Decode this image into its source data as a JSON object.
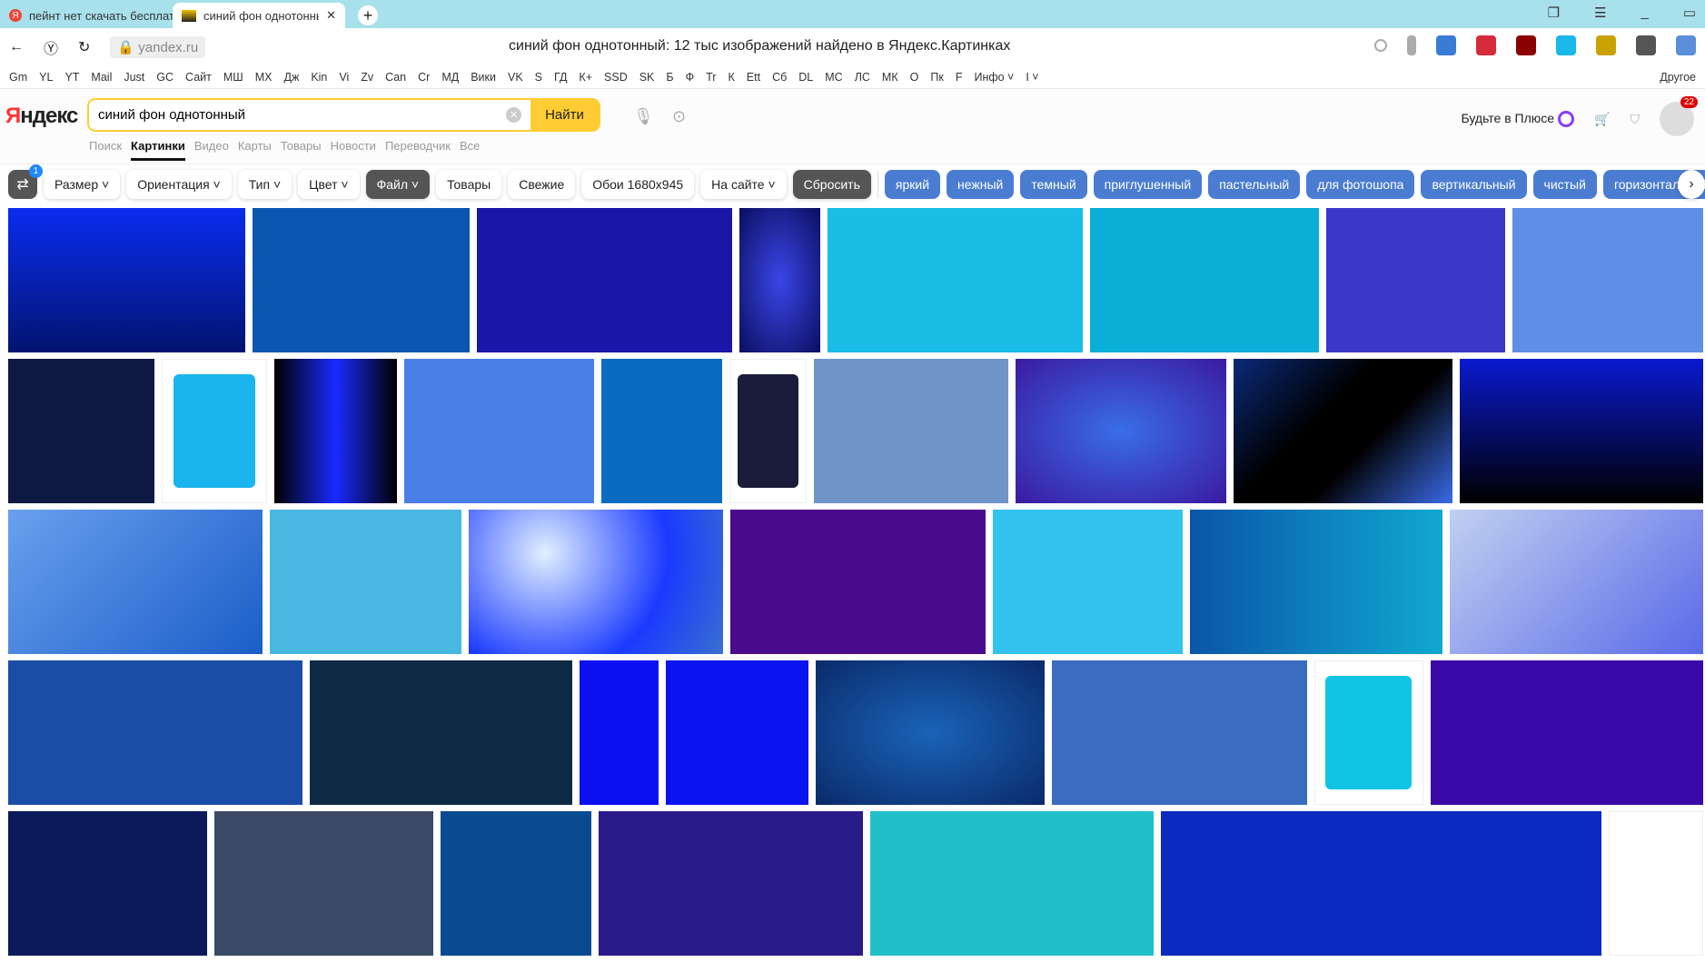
{
  "browser": {
    "tabs": [
      {
        "label": "пейнт нет скачать бесплатно",
        "active": false
      },
      {
        "label": "синий фон однотонный",
        "active": true
      }
    ],
    "url": "yandex.ru",
    "page_title": "синий фон однотонный: 12 тыс изображений найдено в Яндекс.Картинках",
    "bookmarks": [
      "Gm",
      "YL",
      "YT",
      "Mail",
      "Just",
      "GC",
      "Сайт",
      "МШ",
      "МХ",
      "Дж",
      "Kin",
      "Vi",
      "Zv",
      "Can",
      "Cr",
      "МД",
      "Вики",
      "VK",
      "S",
      "ГД",
      "К+",
      "SSD",
      "SK",
      "Б",
      "Ф",
      "Tr",
      "К",
      "Ett",
      "Сб",
      "DL",
      "МС",
      "ЛС",
      "МК",
      "О",
      "Пк",
      "F",
      "Инфо ˅",
      "I ˅"
    ],
    "bookmarks_other": "Другое",
    "extension_colors": [
      "#3a7bd5",
      "#d62b3b",
      "#8b0000",
      "#1ab7ea",
      "#c9a200",
      "#555",
      "#5b8fd9"
    ]
  },
  "header": {
    "logo": "Яндекс",
    "search_value": "синий фон однотонный",
    "find_button": "Найти",
    "services": [
      {
        "label": "Поиск"
      },
      {
        "label": "Картинки",
        "active": true
      },
      {
        "label": "Видео"
      },
      {
        "label": "Карты"
      },
      {
        "label": "Товары"
      },
      {
        "label": "Новости"
      },
      {
        "label": "Переводчик"
      },
      {
        "label": "Все"
      }
    ],
    "plus_label": "Будьте в Плюсе",
    "notifications": "22"
  },
  "filters": {
    "settings_count": "1",
    "buttons": [
      {
        "label": "Размер ˅"
      },
      {
        "label": "Ориентация ˅"
      },
      {
        "label": "Тип ˅"
      },
      {
        "label": "Цвет ˅"
      },
      {
        "label": "Файл ˅",
        "dark": true
      },
      {
        "label": "Товары"
      },
      {
        "label": "Свежие"
      },
      {
        "label": "Обои 1680x945"
      },
      {
        "label": "На сайте ˅"
      },
      {
        "label": "Сбросить",
        "dark": true
      }
    ],
    "tags": [
      "яркий",
      "нежный",
      "темный",
      "приглушенный",
      "пастельный",
      "для фотошопа",
      "вертикальный",
      "чистый",
      "горизонтальный"
    ]
  },
  "grid": [
    [
      {
        "w": 218,
        "bg": "linear-gradient(#0a2cf0,#021470)"
      },
      {
        "w": 199,
        "bg": "#0a56b0"
      },
      {
        "w": 235,
        "bg": "#1a16a8"
      },
      {
        "w": 74,
        "bg": "radial-gradient(#3a46e8,#0a0e60)"
      },
      {
        "w": 235,
        "bg": "#19bde6"
      },
      {
        "w": 210,
        "bg": "#0aaed6"
      },
      {
        "w": 165,
        "bg": "#3a38c8"
      },
      {
        "w": 175,
        "bg": "#5f8ee6"
      }
    ],
    [
      {
        "w": 135,
        "bg": "#0e1a44"
      },
      {
        "w": 95,
        "white": true,
        "inner": "#1ab5ee"
      },
      {
        "w": 113,
        "bg": "linear-gradient(90deg,#000,#1a2aff,#000)"
      },
      {
        "w": 175,
        "bg": "#4a7fe8"
      },
      {
        "w": 111,
        "bg": "#0a6cc0"
      },
      {
        "w": 70,
        "white": true,
        "inner": "#1a1c3a"
      },
      {
        "w": 179,
        "bg": "#6e94c8"
      },
      {
        "w": 194,
        "bg": "radial-gradient(#3a6ee8,#3a1aa0)"
      },
      {
        "w": 202,
        "bg": "linear-gradient(135deg,#0a2a7a,#000 40%,#000 60%,#3a6ae8)"
      },
      {
        "w": 224,
        "bg": "linear-gradient(#0a1ad0,#000)"
      }
    ],
    [
      {
        "w": 234,
        "bg": "linear-gradient(135deg,#6aa0ee,#1a5ec8)"
      },
      {
        "w": 176,
        "bg": "#48b8e2"
      },
      {
        "w": 234,
        "bg": "radial-gradient(circle at 30% 30%,#e0f0ff,#1a3aff 60%,#3a70d0)"
      },
      {
        "w": 234,
        "bg": "#4a0a8c"
      },
      {
        "w": 175,
        "bg": "#33c2ee"
      },
      {
        "w": 232,
        "bg": "linear-gradient(90deg,#0a56a8,#10a8d0)"
      },
      {
        "w": 233,
        "bg": "linear-gradient(135deg,#c0d0f0,#5a6ae8)"
      }
    ],
    [
      {
        "w": 270,
        "bg": "#1a4ea6"
      },
      {
        "w": 241,
        "bg": "#0e2a44"
      },
      {
        "w": 73,
        "bg": "#0a10f0"
      },
      {
        "w": 131,
        "bg": "#0a14f0"
      },
      {
        "w": 210,
        "bg": "radial-gradient(#1a64b8,#0a2a6a)"
      },
      {
        "w": 234,
        "bg": "#3a6cc0"
      },
      {
        "w": 99,
        "white": true,
        "inner": "#12c4e4"
      },
      {
        "w": 250,
        "bg": "#3a0aa8"
      }
    ],
    [
      {
        "w": 183,
        "bg": "#0a1a5a"
      },
      {
        "w": 201,
        "bg": "#3a4a66"
      },
      {
        "w": 138,
        "bg": "#0a4a90"
      },
      {
        "w": 243,
        "bg": "#2a1a8a"
      },
      {
        "w": 260,
        "bg": "#20c0c8"
      },
      {
        "w": 405,
        "bg": "#0a2ac0"
      },
      {
        "w": 85,
        "white": true
      }
    ]
  ]
}
